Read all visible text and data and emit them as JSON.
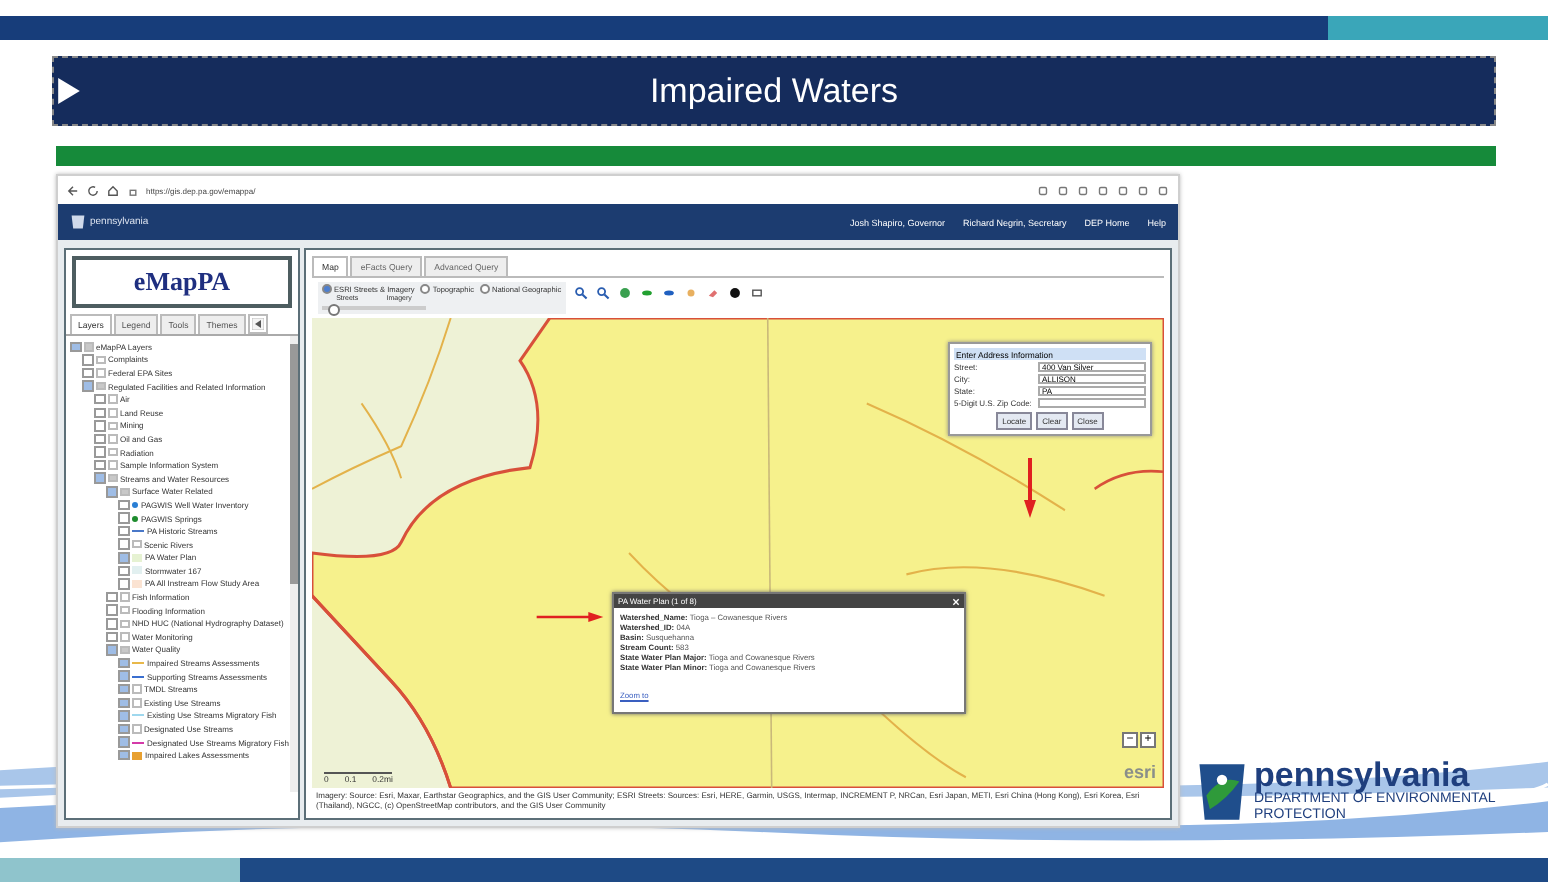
{
  "slide_title": "Impaired Waters",
  "browser": {
    "url": "https://gis.dep.pa.gov/emappa/"
  },
  "site_header": {
    "logo_text": "pennsylvania",
    "nav_links": [
      "Josh Shapiro, Governor",
      "Richard Negrin, Secretary",
      "DEP Home",
      "Help"
    ]
  },
  "left_panel": {
    "app_title": "eMapPA",
    "tabs": [
      {
        "label": "Layers",
        "selected": true
      },
      {
        "label": "Legend",
        "selected": false
      },
      {
        "label": "Tools",
        "selected": false
      },
      {
        "label": "Themes",
        "selected": false
      }
    ],
    "layers": [
      {
        "label": "eMapPA Layers",
        "checked": true,
        "expanded": true,
        "children": [
          {
            "label": "Complaints",
            "checked": false,
            "expanded": false
          },
          {
            "label": "Federal EPA Sites",
            "checked": false,
            "expanded": false
          },
          {
            "label": "Regulated Facilities and Related Information",
            "checked": true,
            "expanded": true,
            "children": [
              {
                "label": "Air",
                "checked": false,
                "expanded": false
              },
              {
                "label": "Land Reuse",
                "checked": false,
                "expanded": false
              },
              {
                "label": "Mining",
                "checked": false,
                "expanded": false
              },
              {
                "label": "Oil and Gas",
                "checked": false,
                "expanded": false
              },
              {
                "label": "Radiation",
                "checked": false,
                "expanded": false
              },
              {
                "label": "Sample Information System",
                "checked": false,
                "expanded": false
              },
              {
                "label": "Streams and Water Resources",
                "checked": true,
                "expanded": true,
                "children": [
                  {
                    "label": "Surface Water Related",
                    "checked": true,
                    "expanded": true,
                    "children": [
                      {
                        "label": "PAGWIS Well Water Inventory",
                        "checked": false,
                        "kind": "dot",
                        "color": "#2a7fd4"
                      },
                      {
                        "label": "PAGWIS Springs",
                        "checked": false,
                        "kind": "dot",
                        "color": "#1e8c2e"
                      },
                      {
                        "label": "PA Historic Streams",
                        "checked": false,
                        "kind": "line",
                        "color": "#4a78c8"
                      },
                      {
                        "label": "Scenic Rivers",
                        "checked": false,
                        "expanded": false
                      },
                      {
                        "label": "PA Water Plan",
                        "checked": true,
                        "kind": "fill",
                        "color": "#e6f2d2"
                      },
                      {
                        "label": "Stormwater 167",
                        "checked": false,
                        "kind": "fill",
                        "color": "#e2f0f0"
                      },
                      {
                        "label": "PA All Instream Flow Study Area",
                        "checked": false,
                        "kind": "fill",
                        "color": "#fbe3d2"
                      }
                    ]
                  },
                  {
                    "label": "Fish Information",
                    "checked": false,
                    "expanded": false
                  },
                  {
                    "label": "Flooding Information",
                    "checked": false,
                    "expanded": false
                  },
                  {
                    "label": "NHD HUC (National Hydrography Dataset)",
                    "checked": false,
                    "expanded": false
                  },
                  {
                    "label": "Water Monitoring",
                    "checked": false,
                    "expanded": false
                  },
                  {
                    "label": "Water Quality",
                    "checked": true,
                    "expanded": true,
                    "children": [
                      {
                        "label": "Impaired Streams Assessments",
                        "checked": true,
                        "kind": "line",
                        "color": "#e8b84a"
                      },
                      {
                        "label": "Supporting Streams Assessments",
                        "checked": true,
                        "kind": "line",
                        "color": "#3a6fd0"
                      },
                      {
                        "label": "TMDL Streams",
                        "checked": true,
                        "expanded": false
                      },
                      {
                        "label": "Existing Use Streams",
                        "checked": true,
                        "expanded": false
                      },
                      {
                        "label": "Existing Use Streams Migratory Fish",
                        "checked": true,
                        "kind": "line",
                        "color": "#9fd8ee"
                      },
                      {
                        "label": "Designated Use Streams",
                        "checked": true,
                        "expanded": false
                      },
                      {
                        "label": "Designated Use Streams Migratory Fish",
                        "checked": true,
                        "kind": "line",
                        "color": "#d43aa8"
                      },
                      {
                        "label": "Impaired Lakes Assessments",
                        "checked": true,
                        "kind": "fill",
                        "color": "#e8a030"
                      }
                    ]
                  }
                ]
              }
            ]
          }
        ]
      }
    ]
  },
  "map_panel": {
    "tabs": [
      {
        "label": "Map",
        "selected": true
      },
      {
        "label": "eFacts Query",
        "selected": false
      },
      {
        "label": "Advanced Query",
        "selected": false
      }
    ],
    "basemaps": [
      {
        "label": "ESRI Streets & Imagery",
        "selected": true
      },
      {
        "label": "Topographic",
        "selected": false
      },
      {
        "label": "National Geographic",
        "selected": false
      }
    ],
    "blend_slider": {
      "left_label": "Streets",
      "right_label": "Imagery",
      "level": 0.05
    },
    "address_form": {
      "title": "Enter Address Information",
      "fields": [
        {
          "label": "Street:",
          "value": "400 Van Silver"
        },
        {
          "label": "City:",
          "value": "ALLISON"
        },
        {
          "label": "State:",
          "value": "PA"
        },
        {
          "label": "5-Digit U.S. Zip Code:"
        }
      ],
      "buttons": [
        "Locate",
        "Clear",
        "Close"
      ]
    },
    "popup": {
      "title": "PA Water Plan (1 of 8)",
      "rows": [
        {
          "label": "Watershed_Name:",
          "value": "Tioga – Cowanesque Rivers"
        },
        {
          "label": "Watershed_ID:",
          "value": "04A"
        },
        {
          "label": "Basin:",
          "value": "Susquehanna"
        },
        {
          "label": "Stream Count:",
          "value": "583"
        },
        {
          "label": "State Water Plan Major:",
          "value": "Tioga and Cowanesque Rivers"
        },
        {
          "label": "State Water Plan Minor:",
          "value": "Tioga and Cowanesque Rivers"
        }
      ],
      "link": "Zoom to"
    },
    "zoom_buttons": [
      "−",
      "+"
    ],
    "esri_logo": "esri",
    "scale_labels": [
      "0",
      "0.1",
      "0.2mi"
    ],
    "attribution": "Imagery: Source: Esri, Maxar, Earthstar Geographics, and the GIS User Community; ESRI Streets: Sources: Esri, HERE, Garmin, USGS, Intermap, INCREMENT P, NRCan, Esri Japan, METI, Esri China (Hong Kong), Esri Korea, Esri (Thailand), NGCC, (c) OpenStreetMap contributors, and the GIS User Community"
  },
  "footer_logo": {
    "name": "pennsylvania",
    "line_1": "DEPARTMENT OF ENVIRONMENTAL",
    "line_2": "PROTECTION"
  }
}
